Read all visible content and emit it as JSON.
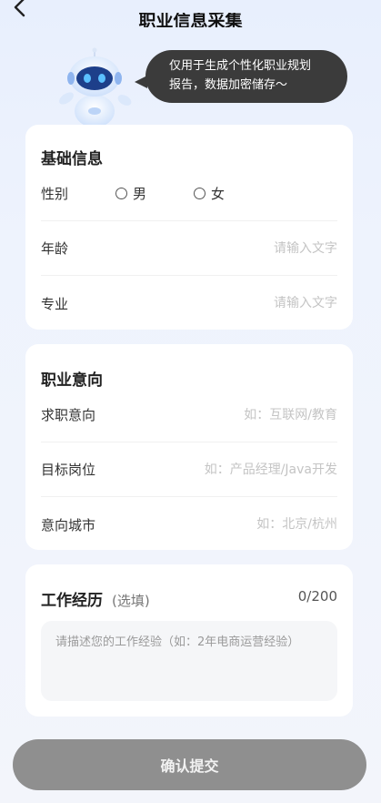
{
  "header": {
    "title": "职业信息采集"
  },
  "hero": {
    "bubble_line1": "仅用于生成个性化职业规划",
    "bubble_line2": "报告，数据加密储存～"
  },
  "basic": {
    "title": "基础信息",
    "gender_label": "性别",
    "gender_options": [
      "男",
      "女"
    ],
    "age_label": "年龄",
    "age_placeholder": "请输入文字",
    "major_label": "专业",
    "major_placeholder": "请输入文字"
  },
  "intention": {
    "title": "职业意向",
    "job_label": "求职意向",
    "job_placeholder": "如：互联网/教育",
    "position_label": "目标岗位",
    "position_placeholder": "如：产品经理/Java开发",
    "city_label": "意向城市",
    "city_placeholder": "如：北京/杭州"
  },
  "experience": {
    "title": "工作经历",
    "optional": "(选填)",
    "counter": "0/200",
    "placeholder": "请描述您的工作经验（如：2年电商运营经验）"
  },
  "submit_label": "确认提交",
  "colors": {
    "accent_bot": "#4a8df6",
    "bubble_bg": "#3b3b3b",
    "button_bg": "#8f8f8f"
  }
}
